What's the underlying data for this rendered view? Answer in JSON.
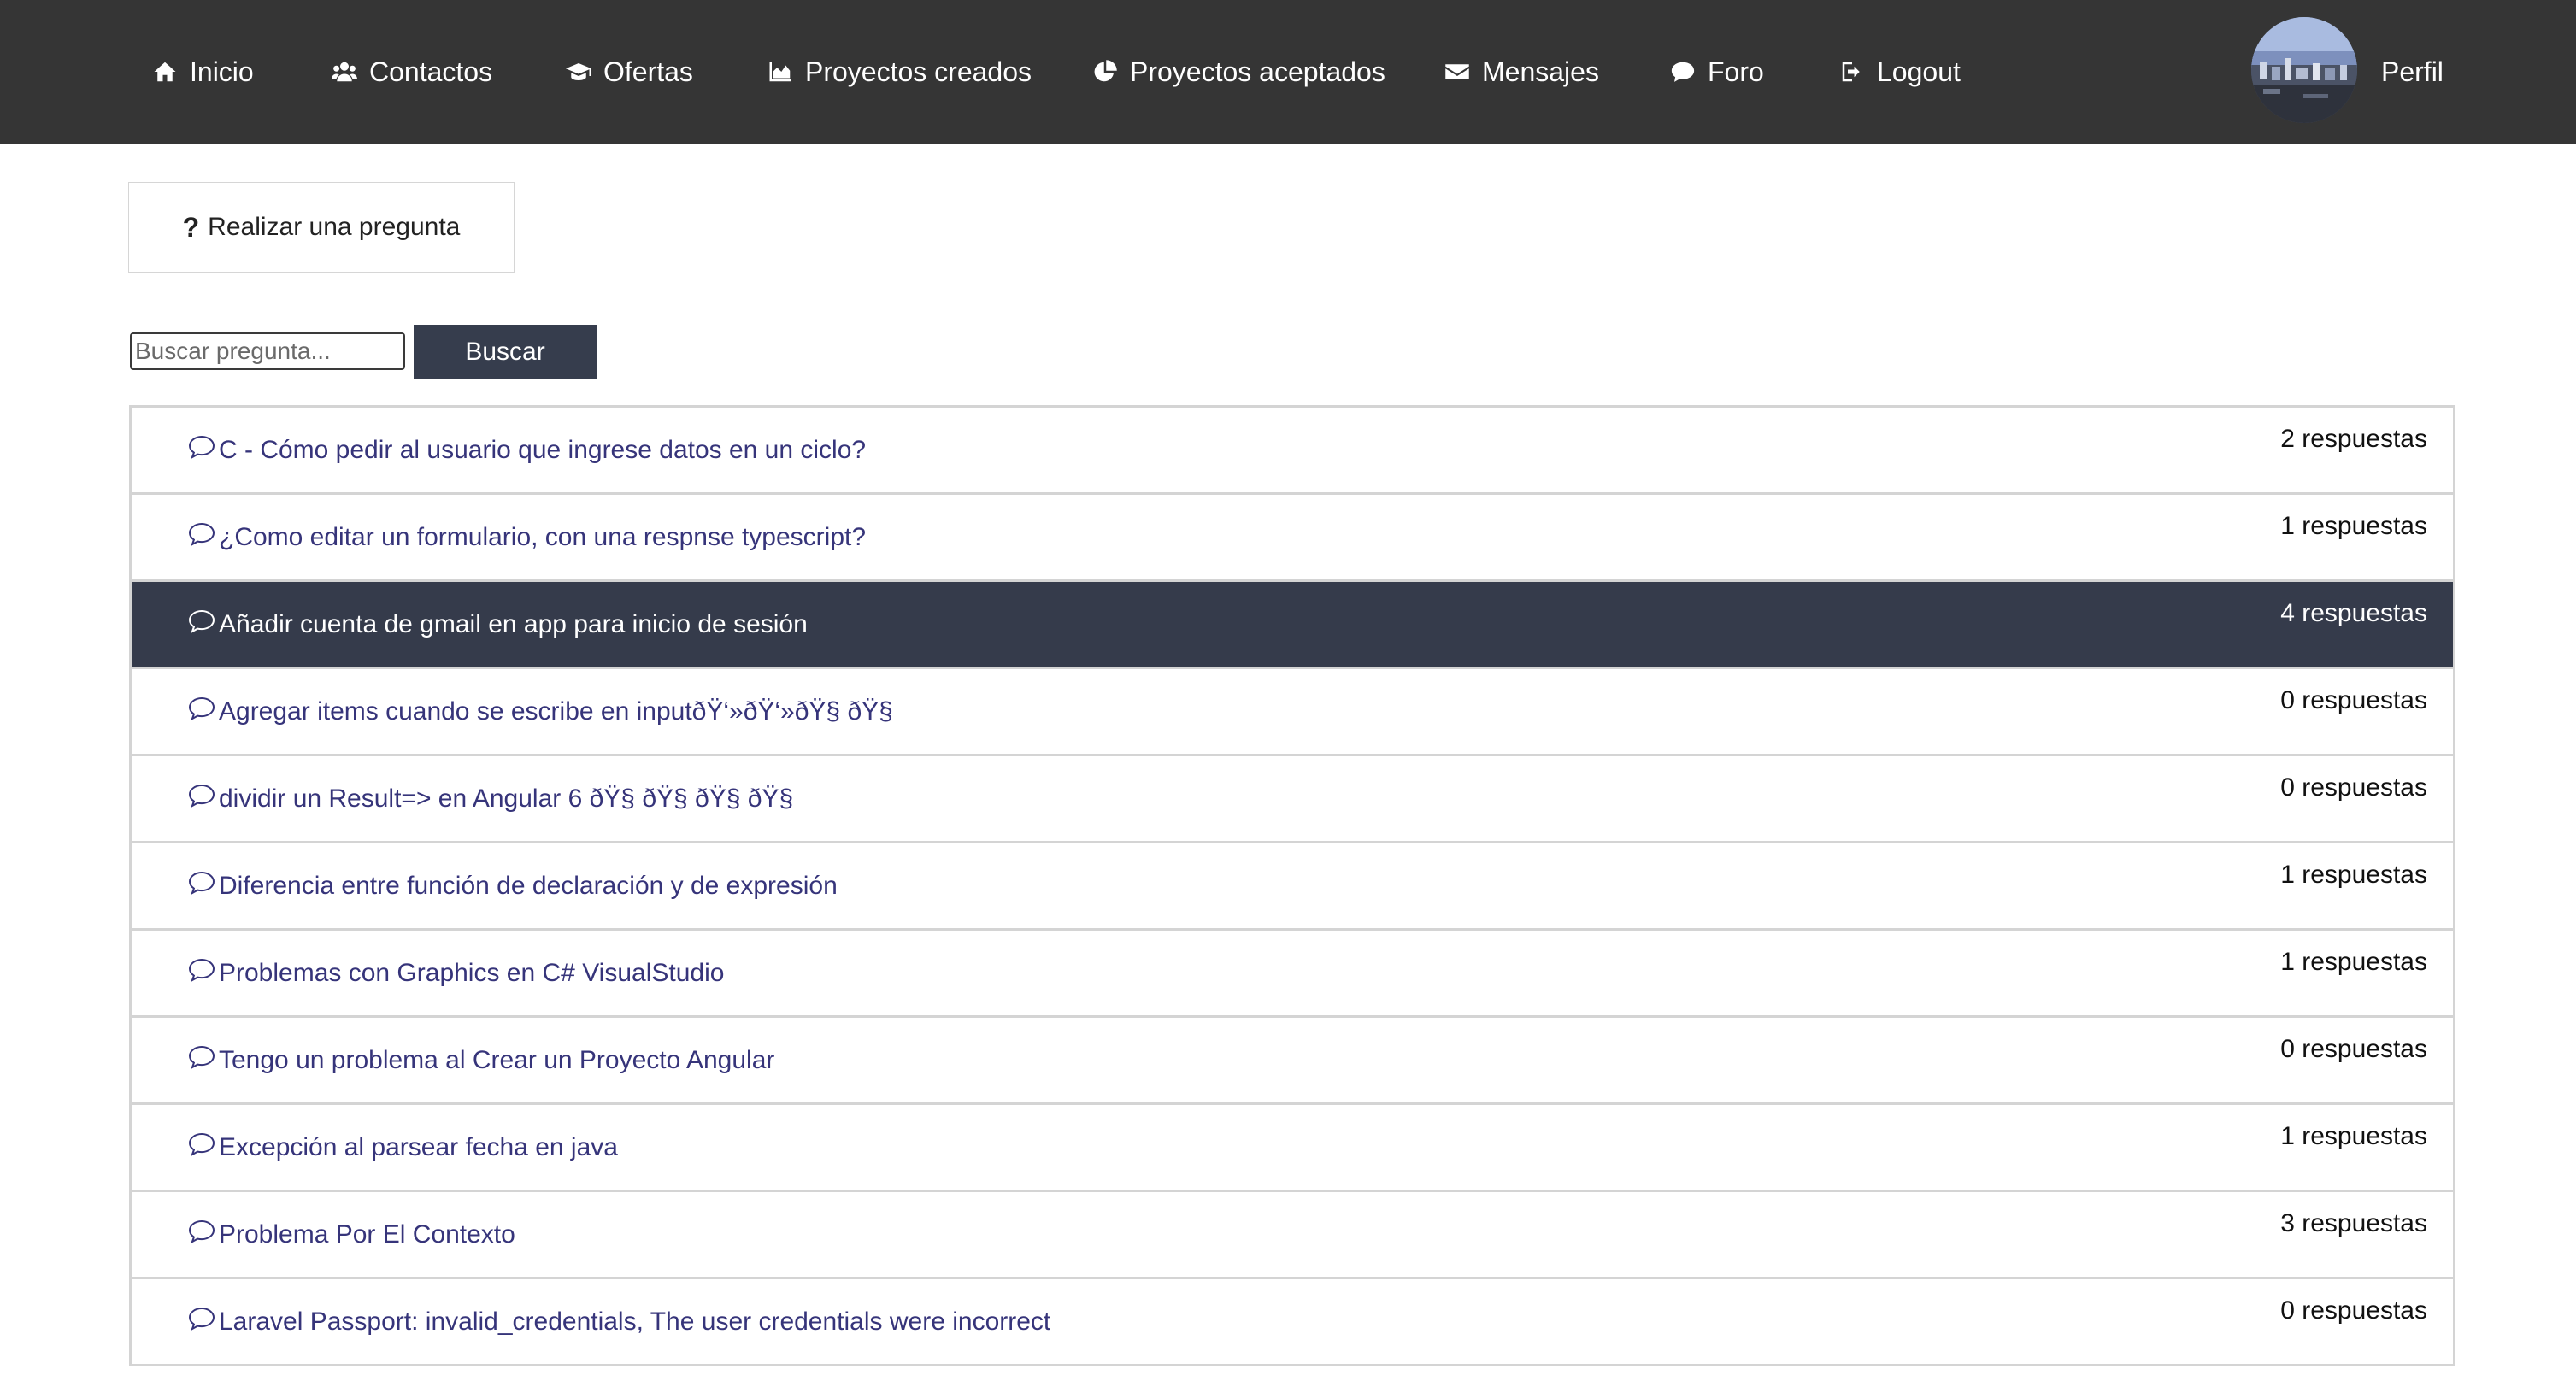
{
  "nav": {
    "items": [
      {
        "label": "Inicio",
        "icon": "home-icon"
      },
      {
        "label": "Contactos",
        "icon": "users-icon"
      },
      {
        "label": "Ofertas",
        "icon": "graduation-cap-icon"
      },
      {
        "label": "Proyectos creados",
        "icon": "area-chart-icon"
      },
      {
        "label": "Proyectos aceptados",
        "icon": "pie-chart-icon"
      },
      {
        "label": "Mensajes",
        "icon": "envelope-icon"
      },
      {
        "label": "Foro",
        "icon": "comment-icon"
      },
      {
        "label": "Logout",
        "icon": "logout-icon"
      }
    ],
    "profile_label": "Perfil"
  },
  "ask": {
    "icon": "question-icon",
    "label": "Realizar una pregunta"
  },
  "search": {
    "placeholder": "Buscar pregunta...",
    "button_label": "Buscar"
  },
  "colors": {
    "navbar_bg": "#353535",
    "link": "#36347a",
    "active_row_bg": "#353b4b",
    "button_bg": "#363d4d"
  },
  "questions": [
    {
      "title": "C - Cómo pedir al usuario que ingrese datos en un ciclo?",
      "answers": "2 respuestas"
    },
    {
      "title": "¿Como editar un formulario, con una respnse typescript?",
      "answers": "1 respuestas"
    },
    {
      "title": "Añadir cuenta de gmail en app para inicio de sesión",
      "answers": "4 respuestas",
      "active": true
    },
    {
      "title": "Agregar items cuando se escribe en inputðŸ‘»ðŸ‘»ðŸ§ ðŸ§",
      "answers": "0 respuestas"
    },
    {
      "title": "dividir un Result=> en Angular 6 ðŸ§ ðŸ§ ðŸ§ ðŸ§",
      "answers": "0 respuestas"
    },
    {
      "title": "Diferencia entre función de declaración y de expresión",
      "answers": "1 respuestas"
    },
    {
      "title": "Problemas con Graphics en C# VisualStudio",
      "answers": "1 respuestas"
    },
    {
      "title": "Tengo un problema al Crear un Proyecto Angular",
      "answers": "0 respuestas"
    },
    {
      "title": "Excepción al parsear fecha en java",
      "answers": "1 respuestas"
    },
    {
      "title": "Problema Por El Contexto",
      "answers": "3 respuestas"
    },
    {
      "title": "Laravel Passport: invalid_credentials, The user credentials were incorrect",
      "answers": "0 respuestas"
    }
  ]
}
